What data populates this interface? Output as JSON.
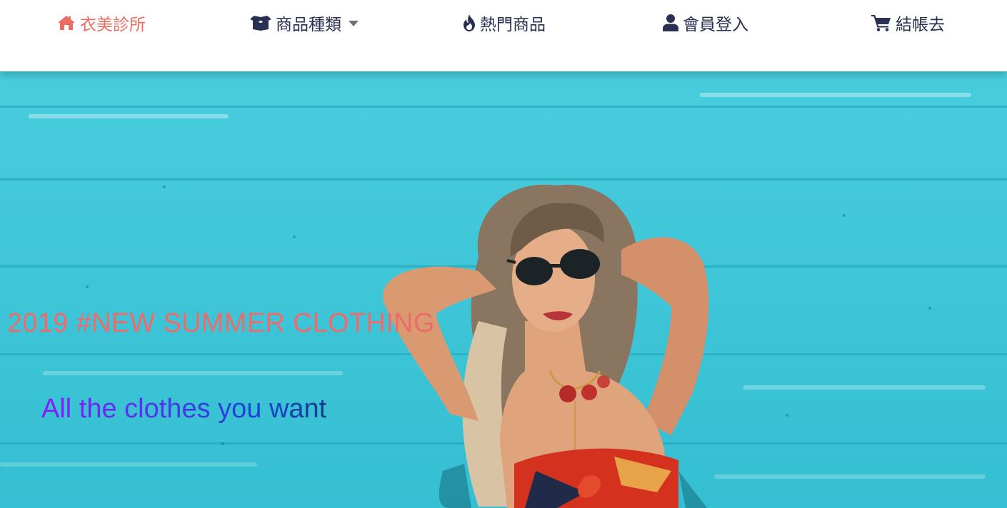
{
  "nav": {
    "items": [
      {
        "label": "衣美診所",
        "icon": "home-icon",
        "active": true
      },
      {
        "label": "商品種類",
        "icon": "box-open-icon",
        "dropdown": true
      },
      {
        "label": "熱門商品",
        "icon": "fire-icon"
      },
      {
        "label": "會員登入",
        "icon": "user-icon"
      },
      {
        "label": "結帳去",
        "icon": "cart-icon"
      }
    ]
  },
  "hero": {
    "title": "2019 #NEW SUMMER CLOTHING",
    "subtitle": "All the clothes you want"
  },
  "colors": {
    "accent": "#ee6b61",
    "nav_text": "#2a3052",
    "hero_bg": "#45c9da",
    "subtitle_gradient_start": "#8b19ff",
    "subtitle_gradient_end": "#173a8a"
  }
}
